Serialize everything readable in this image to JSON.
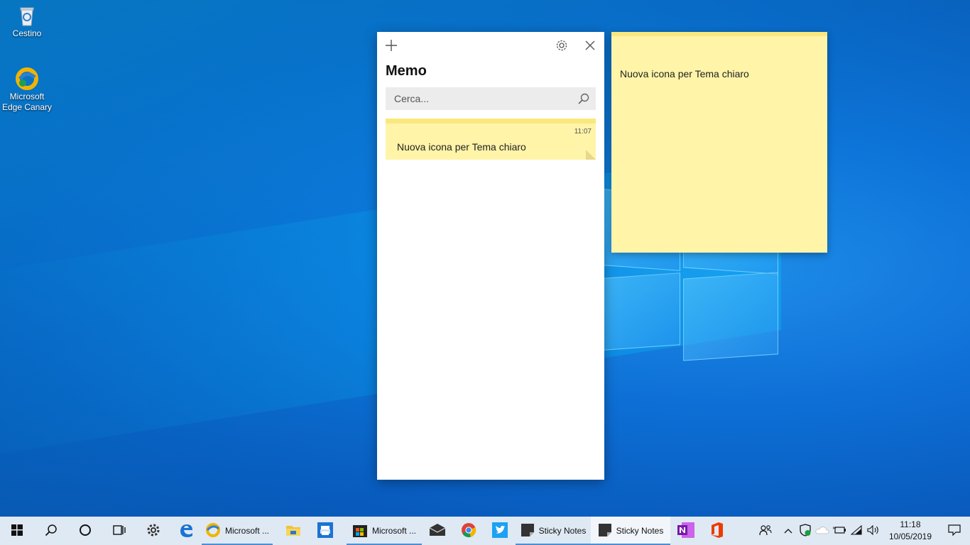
{
  "desktop": {
    "icons": [
      {
        "label": "Cestino",
        "icon": "recycle-bin-icon"
      },
      {
        "label": "Microsoft Edge Canary",
        "icon": "edge-canary-icon"
      }
    ]
  },
  "memo_window": {
    "title": "Memo",
    "add_icon": "plus-icon",
    "settings_icon": "gear-icon",
    "close_icon": "close-icon",
    "search": {
      "placeholder": "Cerca...",
      "icon": "search-icon"
    },
    "notes": [
      {
        "time": "11:07",
        "text": "Nuova icona per Tema chiaro"
      }
    ]
  },
  "sticky_note": {
    "text": "Nuova icona per Tema chiaro"
  },
  "taskbar": {
    "items": [
      {
        "icon": "start-icon"
      },
      {
        "icon": "search-icon"
      },
      {
        "icon": "cortana-icon"
      },
      {
        "icon": "task-view-icon"
      },
      {
        "icon": "settings-icon"
      },
      {
        "icon": "edge-icon"
      },
      {
        "icon": "edge-canary-icon",
        "label": "Microsoft ..."
      },
      {
        "icon": "file-explorer-icon"
      },
      {
        "icon": "printer-icon"
      },
      {
        "icon": "store-icon",
        "label": "Microsoft ..."
      },
      {
        "icon": "mail-icon"
      },
      {
        "icon": "chrome-icon"
      },
      {
        "icon": "twitter-icon"
      },
      {
        "icon": "sticky-notes-icon",
        "label": "Sticky Notes"
      },
      {
        "icon": "sticky-notes-icon",
        "label": "Sticky Notes"
      },
      {
        "icon": "onenote-icon"
      },
      {
        "icon": "office-icon"
      }
    ],
    "clock": {
      "time": "11:18",
      "date": "10/05/2019"
    }
  },
  "colors": {
    "note_yellow": "#fff4a8",
    "note_header": "#f9e87e",
    "taskbar": "#dfe9f3"
  }
}
